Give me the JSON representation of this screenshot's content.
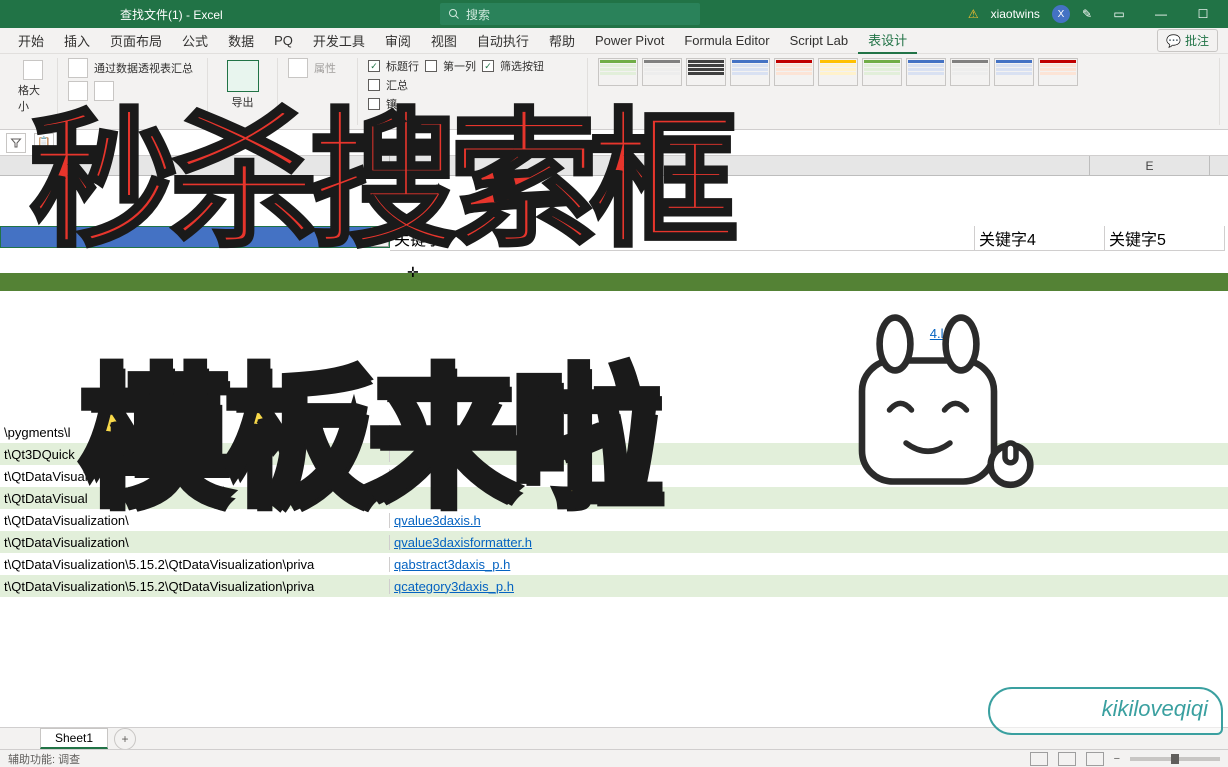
{
  "titlebar": {
    "filename": "查找文件(1)  -  Excel",
    "search_placeholder": "搜索",
    "username": "xiaotwins",
    "user_initial": "X"
  },
  "ribbon_tabs": [
    "开始",
    "插入",
    "页面布局",
    "公式",
    "数据",
    "PQ",
    "开发工具",
    "审阅",
    "视图",
    "自动执行",
    "帮助",
    "Power Pivot",
    "Formula Editor",
    "Script Lab",
    "表设计"
  ],
  "ribbon_active": "表设计",
  "comments_label": "批注",
  "ribbon": {
    "size_label": "格大小",
    "pivot_label": "通过数据透视表汇总",
    "export_label": "导出",
    "props_label": "属性",
    "header_row": "标题行",
    "first_col": "第一列",
    "filter_btn": "筛选按钮",
    "total_row": "汇总",
    "banded": "镶"
  },
  "columns": {
    "b": "B",
    "e": "E",
    "hdr3": "关键字3",
    "hdr4": "关键字4",
    "hdr5": "关键字5"
  },
  "rows": [
    {
      "band": false,
      "path": "\\pygments\\l",
      "link": ""
    },
    {
      "band": true,
      "path": "t\\Qt3DQuick",
      "link": ""
    },
    {
      "band": false,
      "path": "t\\QtDataVisual",
      "link": ""
    },
    {
      "band": true,
      "path": "t\\QtDataVisual",
      "link": ""
    },
    {
      "band": false,
      "path": "t\\QtDataVisualization\\",
      "link": "qvalue3daxis.h"
    },
    {
      "band": true,
      "path": "t\\QtDataVisualization\\",
      "link": "qvalue3daxisformatter.h"
    },
    {
      "band": false,
      "path": "t\\QtDataVisualization\\5.15.2\\QtDataVisualization\\priva",
      "link": "qabstract3daxis_p.h"
    },
    {
      "band": true,
      "path": "t\\QtDataVisualization\\5.15.2\\QtDataVisualization\\priva",
      "link": "qcategory3daxis_p.h"
    }
  ],
  "fragment_link": "4.log",
  "sheet_tab": "Sheet1",
  "status_left": "辅助功能: 调查",
  "overlay1": "秒杀搜索框",
  "overlay2": "模板来啦",
  "watermark": "kikiloveqiqi"
}
